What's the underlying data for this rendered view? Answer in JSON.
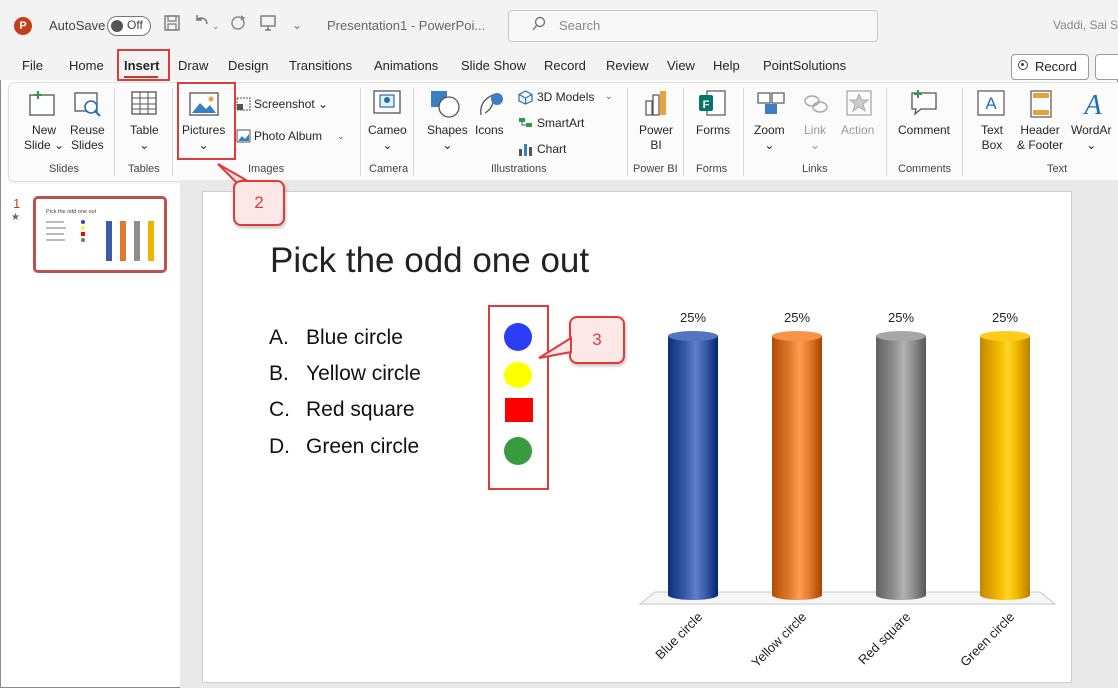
{
  "app": {
    "autosave_label": "AutoSave",
    "autosave_state": "Off",
    "document_title": "Presentation1 - PowerPoi...",
    "search_placeholder": "Search",
    "user_name": "Vaddi, Sai Su"
  },
  "menu": {
    "tabs": [
      "File",
      "Home",
      "Insert",
      "Draw",
      "Design",
      "Transitions",
      "Animations",
      "Slide Show",
      "Record",
      "Review",
      "View",
      "Help",
      "PointSolutions"
    ],
    "active_tab": "Insert",
    "record_button": "Record"
  },
  "ribbon": {
    "new_slide": [
      "New",
      "Slide"
    ],
    "reuse_slides": [
      "Reuse",
      "Slides"
    ],
    "table": "Table",
    "pictures": "Pictures",
    "screenshot": "Screenshot",
    "photo_album": "Photo Album",
    "cameo": "Cameo",
    "shapes": "Shapes",
    "icons": "Icons",
    "models_3d": "3D Models",
    "smartart": "SmartArt",
    "chart": "Chart",
    "power_bi": [
      "Power",
      "BI"
    ],
    "forms": "Forms",
    "zoom": "Zoom",
    "link": "Link",
    "action": "Action",
    "comment": "Comment",
    "text_box": [
      "Text",
      "Box"
    ],
    "header_footer": [
      "Header",
      "& Footer"
    ],
    "wordart": "WordAr",
    "groups": {
      "slides": "Slides",
      "tables": "Tables",
      "images": "Images",
      "camera": "Camera",
      "illustrations": "Illustrations",
      "power_bi": "Power BI",
      "forms": "Forms",
      "links": "Links",
      "comments": "Comments",
      "text": "Text"
    }
  },
  "callouts": {
    "two": "2",
    "three": "3"
  },
  "thumbnails": {
    "slide_number": "1",
    "star": "★"
  },
  "slide": {
    "title": "Pick the odd one out",
    "options": [
      {
        "letter": "A.",
        "text": "Blue circle"
      },
      {
        "letter": "B.",
        "text": "Yellow circle"
      },
      {
        "letter": "C.",
        "text": "Red square"
      },
      {
        "letter": "D.",
        "text": "Green circle"
      }
    ],
    "shape_colors": {
      "blue": "#2b3df5",
      "yellow": "#ffff00",
      "red": "#ff0000",
      "green": "#3a9a3f"
    }
  },
  "chart_data": {
    "type": "bar",
    "style": "3D cylinder",
    "categories": [
      "Blue circle",
      "Yellow circle",
      "Red square",
      "Green circle"
    ],
    "values": [
      25,
      25,
      25,
      25
    ],
    "data_labels": [
      "25%",
      "25%",
      "25%",
      "25%"
    ],
    "colors": [
      "#3a5ba8",
      "#e07a2e",
      "#8e8e8e",
      "#f0b400"
    ],
    "title": "",
    "xlabel": "",
    "ylabel": "",
    "legend": "none",
    "grid": false
  }
}
